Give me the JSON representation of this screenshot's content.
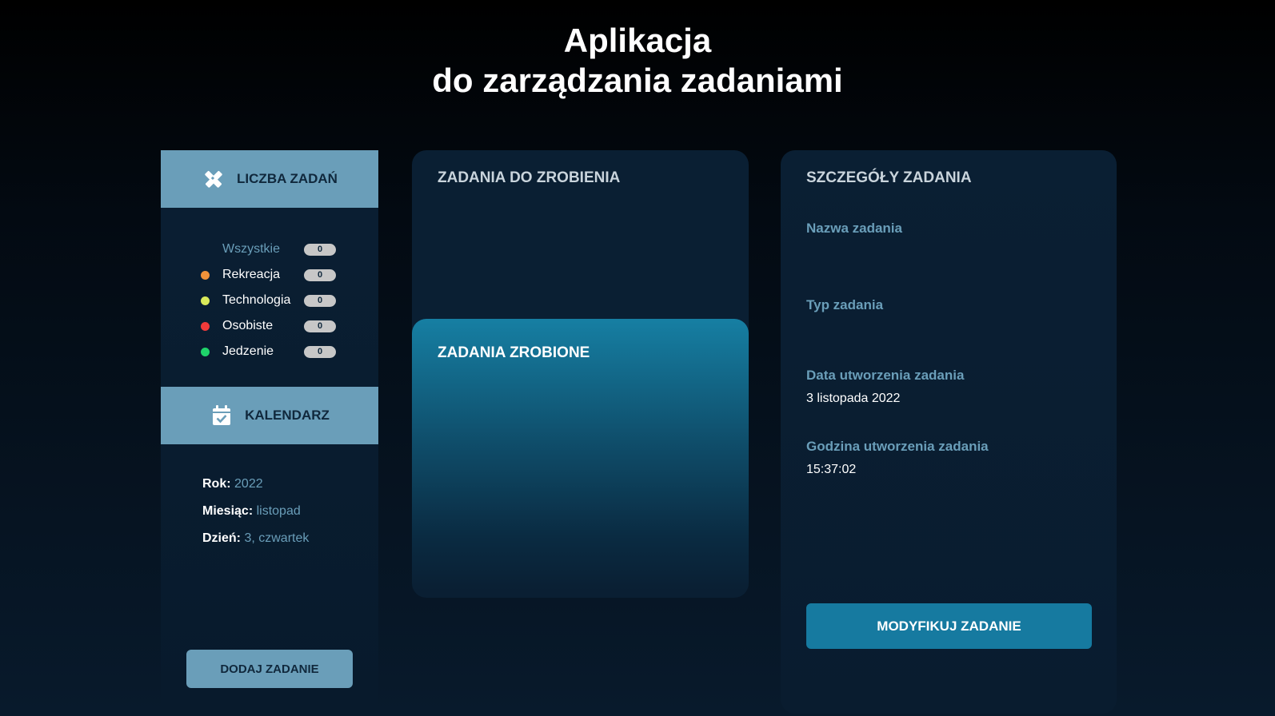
{
  "app": {
    "title_line1": "Aplikacja",
    "title_line2": "do zarządzania zadaniami"
  },
  "sidebar": {
    "counts_header": {
      "label": "LICZBA ZADAŃ",
      "icon": "pencil-ruler-icon"
    },
    "categories": [
      {
        "label": "Wszystkie",
        "count": "0",
        "color": ""
      },
      {
        "label": "Rekreacja",
        "count": "0",
        "color": "#f0923a"
      },
      {
        "label": "Technologia",
        "count": "0",
        "color": "#d9ea5a"
      },
      {
        "label": "Osobiste",
        "count": "0",
        "color": "#f03a3a"
      },
      {
        "label": "Jedzenie",
        "count": "0",
        "color": "#1fd46a"
      }
    ],
    "calendar_header": {
      "label": "KALENDARZ",
      "icon": "calendar-check-icon"
    },
    "calendar": {
      "year_label": "Rok:",
      "year_value": "2022",
      "month_label": "Miesiąc:",
      "month_value": "listopad",
      "day_label": "Dzień:",
      "day_value": "3, czwartek"
    },
    "add_button": "DODAJ ZADANIE"
  },
  "tasks": {
    "todo_title": "ZADANIA DO ZROBIENIA",
    "done_title": "ZADANIA ZROBIONE"
  },
  "details": {
    "title": "SZCZEGÓŁY ZADANIA",
    "name_label": "Nazwa zadania",
    "name_value": "",
    "type_label": "Typ zadania",
    "type_value": "",
    "date_label": "Data utworzenia zadania",
    "date_value": "3 listopada 2022",
    "time_label": "Godzina utworzenia zadania",
    "time_value": "15:37:02",
    "modify_button": "MODYFIKUJ ZADANIE"
  },
  "colors": {
    "accent": "#6a9eb9",
    "primary_button": "#167aa0",
    "panel": "#0a1f33"
  }
}
